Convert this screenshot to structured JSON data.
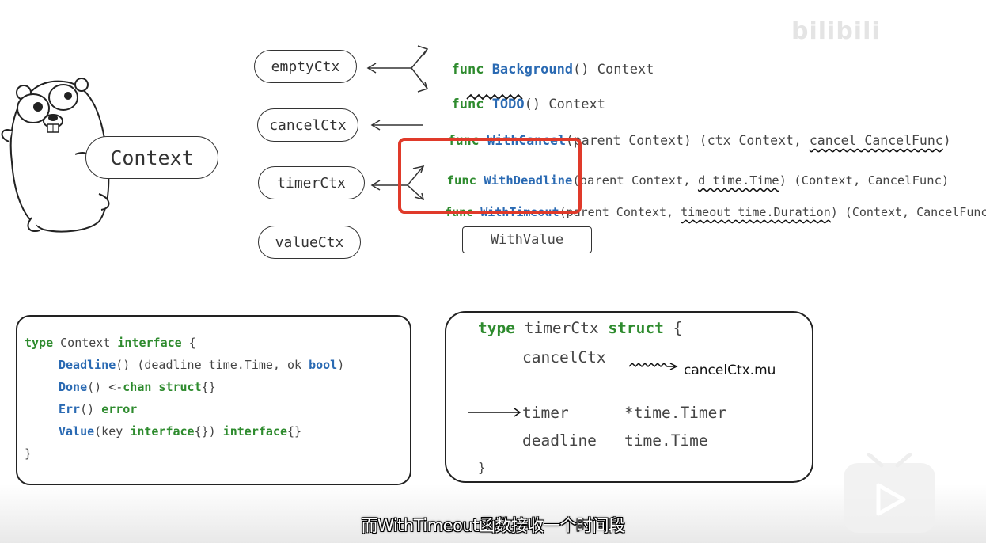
{
  "watermark": "bilibili",
  "gopher": {
    "label": "Context"
  },
  "types": [
    {
      "name": "emptyCtx"
    },
    {
      "name": "cancelCtx"
    },
    {
      "name": "timerCtx"
    },
    {
      "name": "valueCtx"
    }
  ],
  "funcs": {
    "background": {
      "kw": "func",
      "name": "Background",
      "rest": "() Context"
    },
    "todo": {
      "kw": "func",
      "name": "TODO",
      "paren": "()",
      "rest": " Context"
    },
    "withcancel": {
      "kw": "func",
      "name": "WithCancel",
      "rest": "(parent Context) (ctx Context, ",
      "under": "cancel CancelFunc",
      "end": ")"
    },
    "withdeadline": {
      "kw": "func",
      "name": "WithDeadline",
      "rest": "(parent Context, ",
      "under": "d time.Time",
      "end": ") (Context, CancelFunc)"
    },
    "withtimeout": {
      "kw": "func",
      "name": "WithTimeout",
      "rest": "(parent Context, ",
      "under": "timeout time.Duration",
      "end": ") (Context, CancelFunc)"
    },
    "withvalue": "WithValue"
  },
  "interface_code": {
    "l1_kw": "type",
    "l1_name": " Context ",
    "l1_kw2": "interface",
    "l1_end": " {",
    "l2_fn": "Deadline",
    "l2_rest": "() (deadline time.Time, ok ",
    "l2_kw": "bool",
    "l2_end": ")",
    "l3_fn": "Done",
    "l3_rest": "() <-",
    "l3_kw": "chan struct",
    "l3_end": "{}",
    "l4_fn": "Err",
    "l4_rest": "() ",
    "l4_kw": "error",
    "l5_fn": "Value",
    "l5_rest": "(key ",
    "l5_kw": "interface",
    "l5_mid": "{}) ",
    "l5_kw2": "interface",
    "l5_end": "{}",
    "l6": "}"
  },
  "struct_code": {
    "l1_kw": "type",
    "l1_name": " timerCtx ",
    "l1_kw2": "struct",
    "l1_end": " {",
    "l2": "cancelCtx",
    "l2_note": "cancelCtx.mu",
    "l3_name": "timer",
    "l3_type": "*time.Timer",
    "l4_name": "deadline",
    "l4_type": "time.Time",
    "l5": "}"
  },
  "subtitle": "而WithTimeout函数接收一个时间段",
  "colors": {
    "keyword": "#2e8b2e",
    "function": "#2a6ab3",
    "highlight": "#e03a2a"
  }
}
